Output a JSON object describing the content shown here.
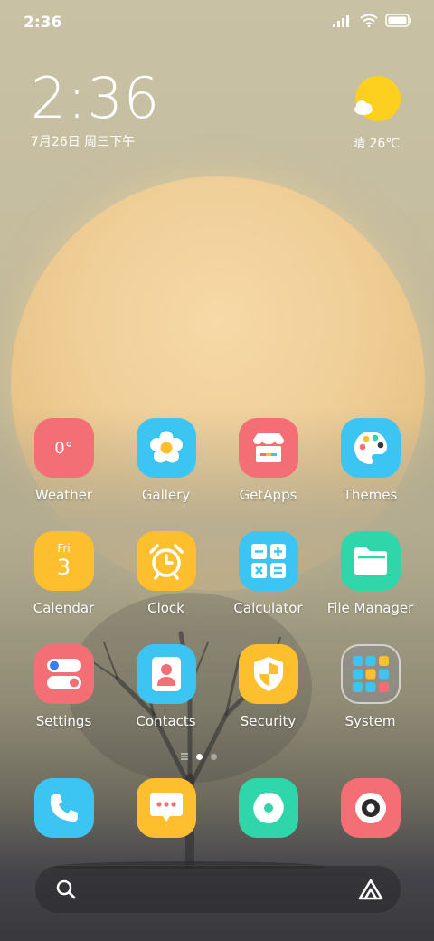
{
  "status_bar": {
    "time": "2:36"
  },
  "clock_widget": {
    "time": "2:36",
    "date": "7月26日 周三下午"
  },
  "weather_widget": {
    "text": "晴 26℃",
    "icon": "sunny-cloud-icon"
  },
  "apps": [
    [
      {
        "label": "Weather",
        "icon": "weather-icon",
        "icon_text": "0°",
        "color": "#f36f75"
      },
      {
        "label": "Gallery",
        "icon": "flower-icon",
        "color": "#3cc5f3"
      },
      {
        "label": "GetApps",
        "icon": "store-icon",
        "color": "#f36f75"
      },
      {
        "label": "Themes",
        "icon": "palette-icon",
        "color": "#3cc5f3"
      }
    ],
    [
      {
        "label": "Calendar",
        "icon": "calendar-icon",
        "icon_day": "Fri",
        "icon_date": "3",
        "color": "#fdbf2d"
      },
      {
        "label": "Clock",
        "icon": "alarm-clock-icon",
        "color": "#fdbf2d"
      },
      {
        "label": "Calculator",
        "icon": "calculator-icon",
        "color": "#3cc5f3"
      },
      {
        "label": "File Manager",
        "icon": "folder-icon",
        "color": "#2fd6a9"
      }
    ],
    [
      {
        "label": "Settings",
        "icon": "toggle-icon",
        "color": "#f36f75"
      },
      {
        "label": "Contacts",
        "icon": "contact-card-icon",
        "color": "#3cc5f3"
      },
      {
        "label": "Security",
        "icon": "shield-icon",
        "color": "#fdbf2d"
      },
      {
        "label": "System",
        "icon": "folder-grid-icon",
        "color": "#8c8c8c"
      }
    ]
  ],
  "dock": [
    {
      "icon": "phone-icon",
      "color": "#3cc5f3"
    },
    {
      "icon": "message-icon",
      "color": "#fdbf2d"
    },
    {
      "icon": "shutter-icon",
      "color": "#2fd6a9"
    },
    {
      "icon": "camera-icon",
      "color": "#f36f75"
    }
  ],
  "page_indicator": {
    "pages": 2,
    "current": 1
  }
}
